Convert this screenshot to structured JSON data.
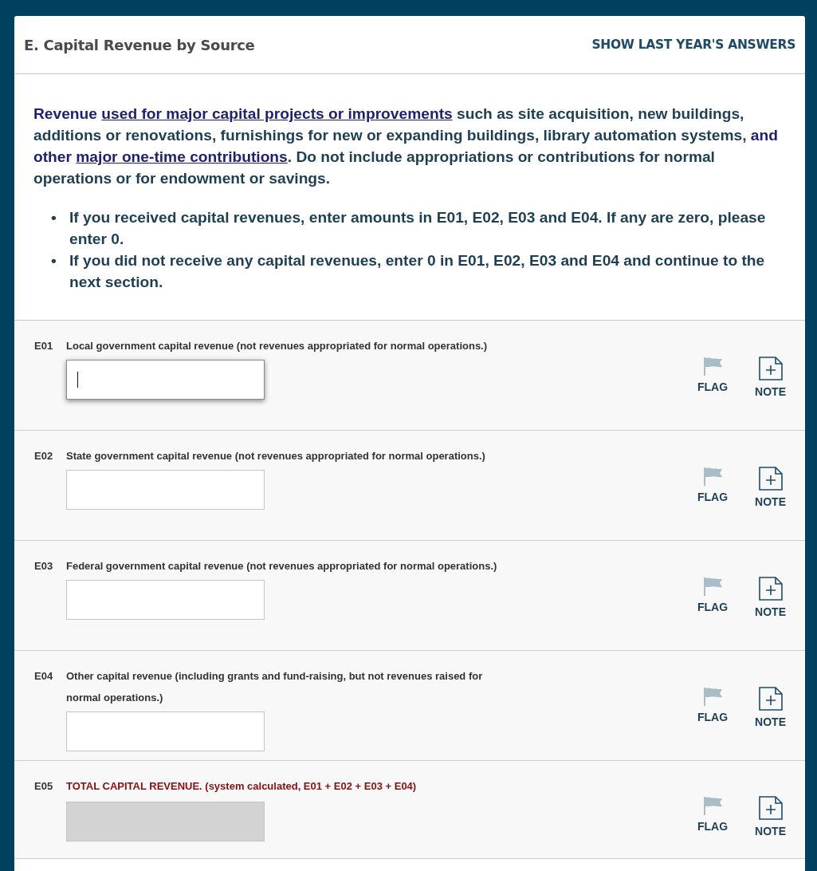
{
  "section": {
    "title": "E. Capital Revenue by Source",
    "action": "SHOW LAST YEAR'S ANSWERS"
  },
  "intro": [
    {
      "kind": "emphasis",
      "text": "Revenue "
    },
    {
      "kind": "link",
      "text": "used for major capital projects or improvements"
    },
    {
      "kind": "plain",
      "text": " such as site acquisition, new buildings, additions or renovations, furnishings for new or expanding buildings, library automation systems, "
    },
    {
      "kind": "emphasis",
      "text": "and other "
    },
    {
      "kind": "link",
      "text": "major one-time contributions"
    },
    {
      "kind": "plain",
      "text": ". Do not include appropriations or contributions for normal operations or for endowment or savings."
    }
  ],
  "bullets": [
    {
      "marker": "•",
      "text": "If you received capital revenues, enter amounts in E01, E02, E03 and E04. If any are zero, please enter 0."
    },
    {
      "marker": "•",
      "text": "If you did not receive any capital revenues, enter 0 in E01, E02, E03 and E04 and continue to the next section."
    }
  ],
  "items": [
    {
      "code": "E01",
      "label": "Local government capital revenue (not revenues appropriated for normal operations.)",
      "kind": "input",
      "focused": true,
      "flag": "FLAG",
      "note": "NOTE"
    },
    {
      "code": "E02",
      "label": "State government capital revenue (not revenues appropriated for normal operations.)",
      "kind": "input",
      "focused": false,
      "flag": "FLAG",
      "note": "NOTE"
    },
    {
      "code": "E03",
      "label": "Federal government capital revenue (not revenues appropriated for normal operations.)",
      "kind": "input",
      "focused": false,
      "flag": "FLAG",
      "note": "NOTE"
    },
    {
      "code": "E04",
      "label": "Other capital revenue (including grants and fund-raising, but not revenues raised for normal operations.)",
      "kind": "input",
      "focused": false,
      "flag": "FLAG",
      "note": "NOTE"
    },
    {
      "code": "E05",
      "label": "TOTAL CAPITAL REVENUE. (system calculated, E01 + E02 + E03 + E04)",
      "kind": "total",
      "focused": false,
      "flag": "FLAG",
      "note": "NOTE"
    }
  ]
}
